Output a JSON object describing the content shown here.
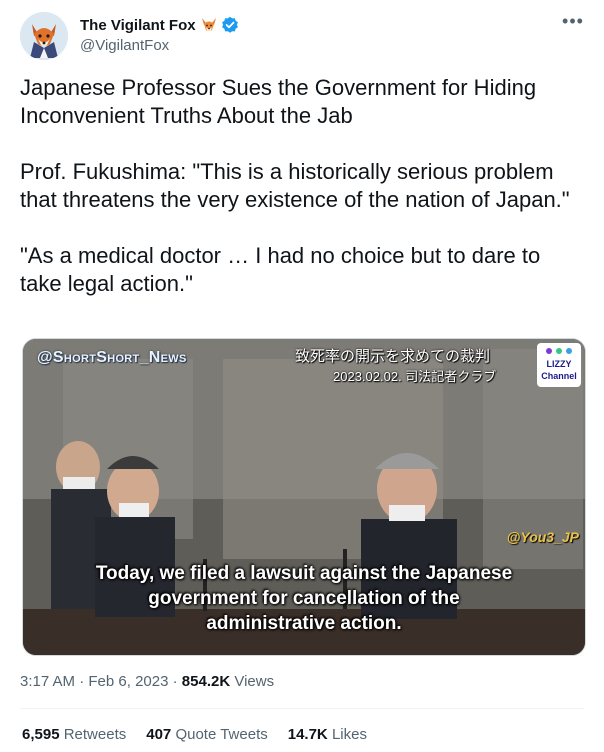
{
  "author": {
    "display_name": "The Vigilant Fox",
    "handle": "@VigilantFox"
  },
  "tweet": {
    "paragraphs": [
      "Japanese Professor Sues the Government for Hiding Inconvenient Truths About the Jab",
      "Prof. Fukushima: \"This is a historically serious problem that threatens the very existence of the nation of Japan.\"",
      "\"As a medical doctor … I had no choice but to dare to take legal action.\""
    ]
  },
  "media": {
    "watermark_left": "@ShortShort_News",
    "jp_title": "致死率の開示を求めての裁判",
    "jp_date": "2023.02.02. 司法記者クラブ",
    "channel_badge_top": "LIZZY",
    "channel_badge_bottom": "Channel",
    "watermark_right": "@You3_JP",
    "caption_lines": [
      "Today, we filed a lawsuit against the Japanese",
      "government for cancellation of the",
      "administrative action."
    ]
  },
  "meta": {
    "time": "3:17 AM",
    "separator": "·",
    "date": "Feb 6, 2023",
    "views_count": "854.2K",
    "views_label": "Views"
  },
  "stats": {
    "retweets_count": "6,595",
    "retweets_label": "Retweets",
    "quotes_count": "407",
    "quotes_label": "Quote Tweets",
    "likes_count": "14.7K",
    "likes_label": "Likes"
  },
  "colors": {
    "text_primary": "#0f1419",
    "text_secondary": "#536471",
    "verified_blue": "#1d9bf0",
    "divider": "#eff3f4"
  },
  "icons": [
    "fox-avatar",
    "fox-emoji-icon",
    "verified-badge-icon",
    "more-options-icon"
  ]
}
